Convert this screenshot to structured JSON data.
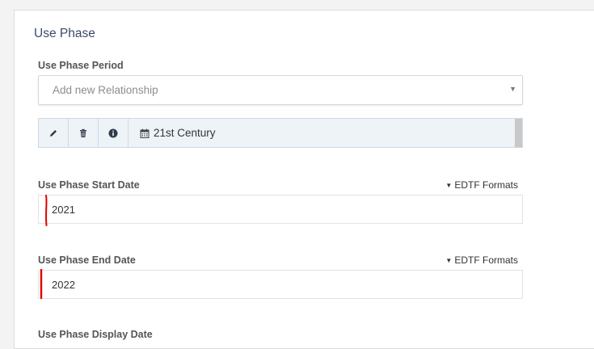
{
  "section": {
    "title": "Use Phase"
  },
  "period": {
    "label": "Use Phase Period",
    "placeholder": "Add new Relationship",
    "relationship_value": "21st Century",
    "actions": [
      "edit-icon",
      "trash-icon",
      "info-icon"
    ]
  },
  "start_date": {
    "label": "Use Phase Start Date",
    "formats_link": "EDTF Formats",
    "value": "2021"
  },
  "end_date": {
    "label": "Use Phase End Date",
    "formats_link": "EDTF Formats",
    "value": "2022"
  },
  "display_date": {
    "label": "Use Phase Display Date"
  },
  "colors": {
    "title": "#3a4a68",
    "row_bg": "#eef3f8",
    "annotation": "#e00000"
  }
}
